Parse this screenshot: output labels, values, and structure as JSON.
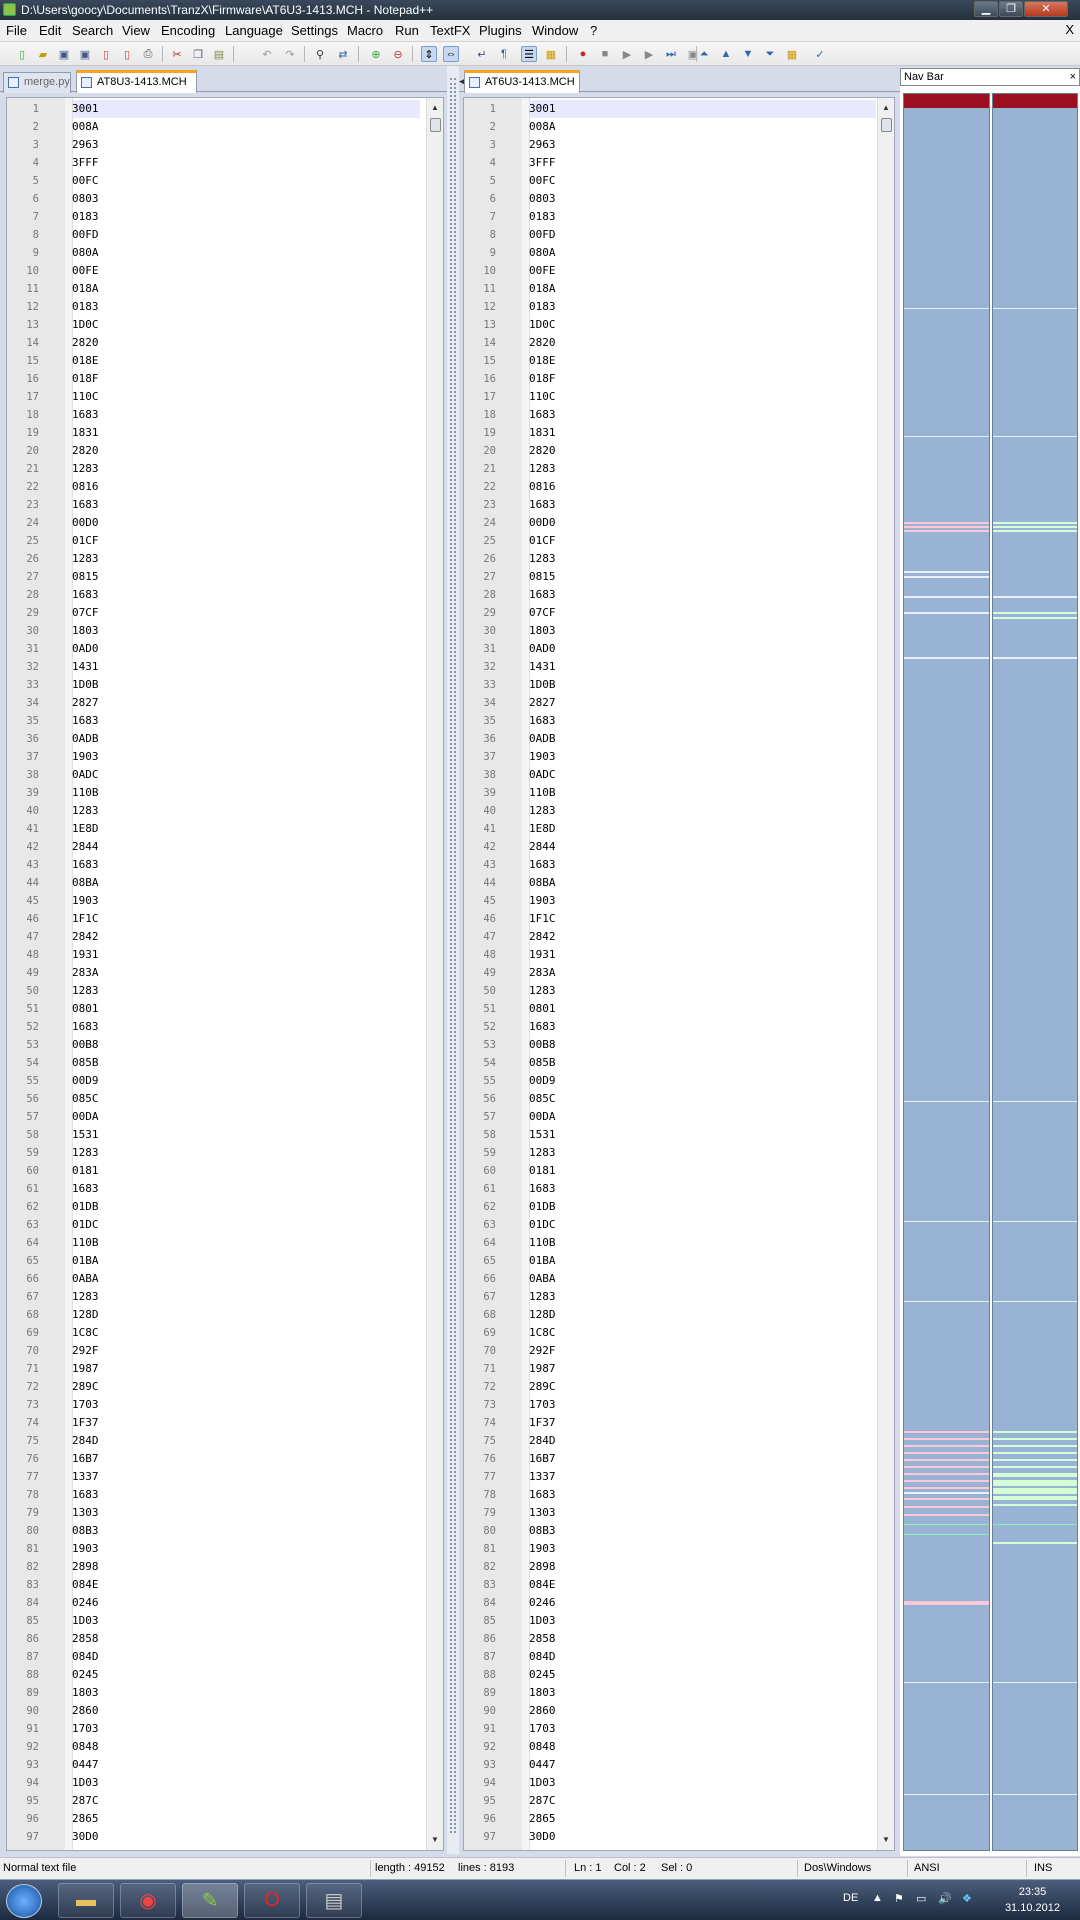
{
  "window": {
    "title": "D:\\Users\\goocy\\Documents\\TranzX\\Firmware\\AT6U3-1413.MCH - Notepad++"
  },
  "menu": [
    "File",
    "Edit",
    "Search",
    "View",
    "Encoding",
    "Language",
    "Settings",
    "Macro",
    "Run",
    "TextFX",
    "Plugins",
    "Window",
    "?"
  ],
  "menu_close": "X",
  "left_tabs": [
    {
      "label": "merge.py",
      "active": false
    },
    {
      "label": "AT8U3-1413.MCH",
      "active": true
    }
  ],
  "right_tabs": [
    {
      "label": "AT6U3-1413.MCH",
      "active": true
    }
  ],
  "left_lines": [
    "3001",
    "008A",
    "2963",
    "3FFF",
    "00FC",
    "0803",
    "0183",
    "00FD",
    "080A",
    "00FE",
    "018A",
    "0183",
    "1D0C",
    "2820",
    "018E",
    "018F",
    "110C",
    "1683",
    "1831",
    "2820",
    "1283",
    "0816",
    "1683",
    "00D0",
    "01CF",
    "1283",
    "0815",
    "1683",
    "07CF",
    "1803",
    "0AD0",
    "1431",
    "1D0B",
    "2827",
    "1683",
    "0ADB",
    "1903",
    "0ADC",
    "110B",
    "1283",
    "1E8D",
    "2844",
    "1683",
    "08BA",
    "1903",
    "1F1C",
    "2842",
    "1931",
    "283A",
    "1283",
    "0801",
    "1683",
    "00B8",
    "085B",
    "00D9",
    "085C",
    "00DA",
    "1531",
    "1283",
    "0181",
    "1683",
    "01DB",
    "01DC",
    "110B",
    "01BA",
    "0ABA",
    "1283",
    "128D",
    "1C8C",
    "292F",
    "1987",
    "289C",
    "1703",
    "1F37",
    "284D",
    "16B7",
    "1337",
    "1683",
    "1303",
    "08B3",
    "1903",
    "2898",
    "084E",
    "0246",
    "1D03",
    "2858",
    "084D",
    "0245",
    "1803",
    "2860",
    "1703",
    "0848",
    "0447",
    "1D03",
    "287C",
    "2865",
    "30D0"
  ],
  "right_lines": [
    "3001",
    "008A",
    "2963",
    "3FFF",
    "00FC",
    "0803",
    "0183",
    "00FD",
    "080A",
    "00FE",
    "018A",
    "0183",
    "1D0C",
    "2820",
    "018E",
    "018F",
    "110C",
    "1683",
    "1831",
    "2820",
    "1283",
    "0816",
    "1683",
    "00D0",
    "01CF",
    "1283",
    "0815",
    "1683",
    "07CF",
    "1803",
    "0AD0",
    "1431",
    "1D0B",
    "2827",
    "1683",
    "0ADB",
    "1903",
    "0ADC",
    "110B",
    "1283",
    "1E8D",
    "2844",
    "1683",
    "08BA",
    "1903",
    "1F1C",
    "2842",
    "1931",
    "283A",
    "1283",
    "0801",
    "1683",
    "00B8",
    "085B",
    "00D9",
    "085C",
    "00DA",
    "1531",
    "1283",
    "0181",
    "1683",
    "01DB",
    "01DC",
    "110B",
    "01BA",
    "0ABA",
    "1283",
    "128D",
    "1C8C",
    "292F",
    "1987",
    "289C",
    "1703",
    "1F37",
    "284D",
    "16B7",
    "1337",
    "1683",
    "1303",
    "08B3",
    "1903",
    "2898",
    "084E",
    "0246",
    "1D03",
    "2858",
    "084D",
    "0245",
    "1803",
    "2860",
    "1703",
    "0848",
    "0447",
    "1D03",
    "287C",
    "2865",
    "30D0"
  ],
  "navbar": {
    "title": "Nav Bar",
    "close": "×"
  },
  "status": {
    "filetype": "Normal text file",
    "length": "length : 49152",
    "lines": "lines : 8193",
    "ln": "Ln : 1",
    "col": "Col : 2",
    "sel": "Sel : 0",
    "eol": "Dos\\Windows",
    "encoding": "ANSI",
    "mode": "INS"
  },
  "taskbar": {
    "lang": "DE",
    "time": "23:35",
    "date": "31.10.2012"
  },
  "colors": {
    "nav_bg": "#98b3d3",
    "diff_pink": "#ffc8d8",
    "diff_green": "#d4ffd4",
    "tab_accent": "#f7a31c"
  }
}
